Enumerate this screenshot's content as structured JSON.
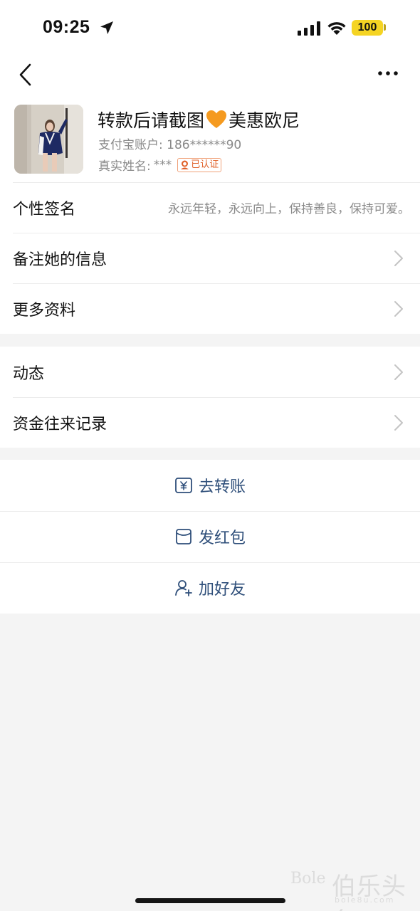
{
  "status_bar": {
    "time": "09:25",
    "battery": "100",
    "icons": [
      "location-arrow-icon",
      "cellular-signal-icon",
      "wifi-icon",
      "battery-icon"
    ],
    "battery_color": "#f5d423"
  },
  "nav": {
    "back_icon": "chevron-left-icon",
    "more_icon": "ellipsis-icon"
  },
  "profile": {
    "nickname_before": "转款后请截图",
    "heart_icon": "orange-heart-icon",
    "nickname_after": "美惠欧尼",
    "account_label": "支付宝账户:",
    "account_value": "186******90",
    "name_label": "真实姓名:",
    "name_value": "***",
    "verified_badge": "已认证"
  },
  "info_rows": [
    {
      "label": "个性签名",
      "value": "永远年轻，永远向上，保持善良，保持可爱。"
    },
    {
      "label": "备注她的信息"
    },
    {
      "label": "更多资料"
    }
  ],
  "records_rows": [
    {
      "label": "动态"
    },
    {
      "label": "资金往来记录"
    }
  ],
  "actions": [
    {
      "label": "去转账",
      "icon": "transfer-yuan-icon"
    },
    {
      "label": "发红包",
      "icon": "red-envelope-icon"
    },
    {
      "label": "加好友",
      "icon": "add-friend-icon"
    }
  ],
  "watermark": {
    "latin": "Bole",
    "cn": "伯乐头条",
    "sub": "bole8u.com"
  },
  "colors": {
    "accent_text": "#2f4f7a",
    "secondary_text": "#8a8a8a",
    "badge": "#e0622a",
    "background": "#f4f4f4"
  }
}
